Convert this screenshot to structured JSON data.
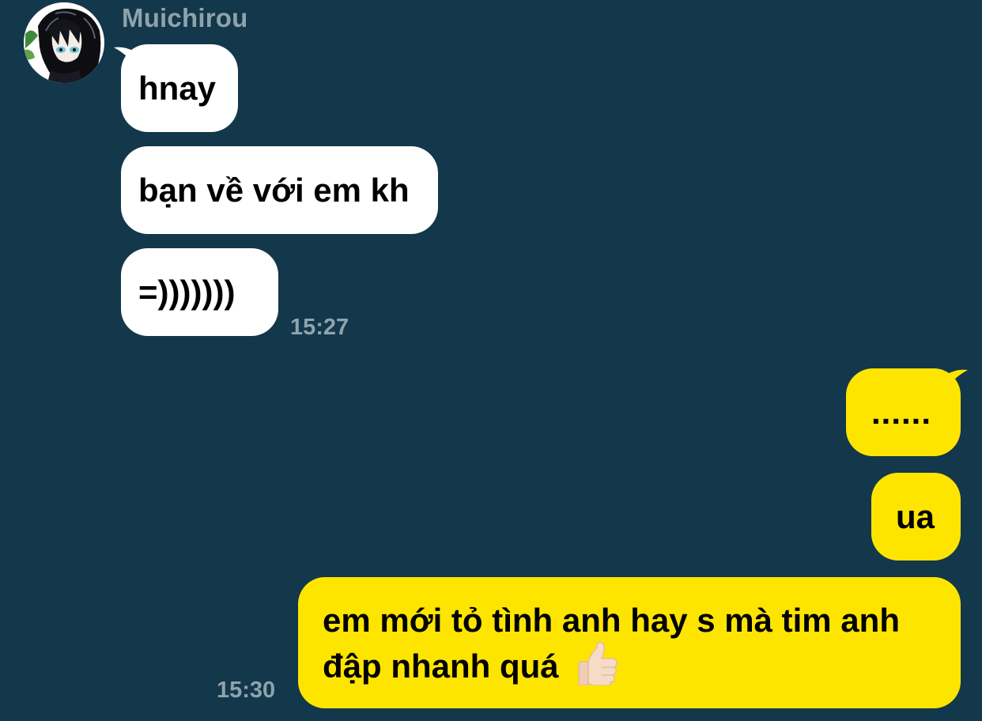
{
  "contact": {
    "name": "Muichirou",
    "avatar_icon": "anime-avatar-icon"
  },
  "incoming": {
    "messages": [
      "hnay",
      "bạn về với em kh",
      "=)))))))"
    ],
    "time": "15:27"
  },
  "outgoing": {
    "messages": [
      "......",
      "ua",
      "em mới tỏ tình anh hay s mà tim anh",
      "đập nhanh quá"
    ],
    "emoji": "thumbs-up-icon",
    "time": "15:30"
  },
  "colors": {
    "background": "#13374b",
    "incoming_bubble": "#ffffff",
    "outgoing_bubble": "#fee500",
    "meta_text": "#8fa3ad"
  }
}
